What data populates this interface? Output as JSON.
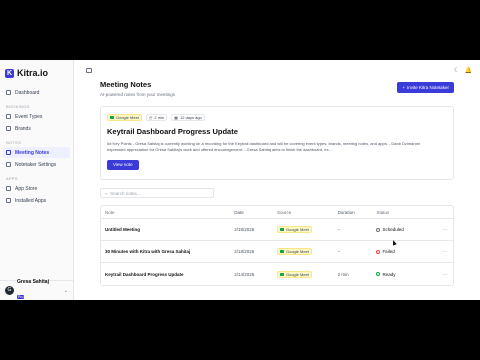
{
  "app": {
    "logo_mark": "K",
    "logo_text": "Kitra.io"
  },
  "sidebar": {
    "dashboard": "Dashboard",
    "bookings_section": "BOOKINGS",
    "bookings": [
      "Event Types",
      "Brands"
    ],
    "notes_section": "NOTES",
    "notes": [
      "Meeting Notes",
      "Notetaker Settings"
    ],
    "apps_section": "APPS",
    "apps": [
      "App Store",
      "Installed Apps"
    ],
    "user": {
      "initial": "G",
      "name": "Gresa Sahitaj",
      "badge": "Pro",
      "chevron": "⌄"
    }
  },
  "topbar": {
    "theme_icon": "☾",
    "bell_icon": "🔔"
  },
  "page": {
    "title": "Meeting Notes",
    "subtitle": "AI-powered notes from your meetings",
    "invite_button": "Invite Kitra Notetaker"
  },
  "latest": {
    "source": "Google Meet",
    "duration": "2 min",
    "age": "12 days ago",
    "title": "Keytrail Dashboard Progress Update",
    "summary": "## Key Points - Gresa Sahitaj is currently working on a recording for the Keytrail dashboard and will be covering event types, brands, meeting notes, and apps. - Dardi Dzimaroni expressed appreciation for Gresa Sahitaj's work and offered encouragement. - Gresa Sahitaj aims to finish the dashboard, ex...",
    "view_button": "View note"
  },
  "search": {
    "placeholder": "Search notes..."
  },
  "table": {
    "headers": {
      "note": "Note",
      "date": "Date",
      "source": "Source",
      "duration": "Duration",
      "status": "Status"
    },
    "rows": [
      {
        "note": "Untitled Meeting",
        "date": "2/18/2026",
        "source": "Google Meet",
        "duration": "–",
        "status": "Scheduled",
        "status_kind": "scheduled",
        "actions": "···"
      },
      {
        "note": "30 Minutes with Kitra with Gresa Sahitaj",
        "date": "2/18/2026",
        "source": "Google Meet",
        "duration": "–",
        "status": "Failed",
        "status_kind": "failed",
        "actions": "···"
      },
      {
        "note": "Keytrail Dashboard Progress Update",
        "date": "2/14/2026",
        "source": "Google Meet",
        "duration": "2 min",
        "status": "Ready",
        "status_kind": "ready",
        "actions": "···"
      }
    ]
  },
  "colors": {
    "accent": "#3b3bd9",
    "ready": "#16a34a",
    "failed": "#ef4444",
    "meet_chip": "#fef9c3"
  }
}
